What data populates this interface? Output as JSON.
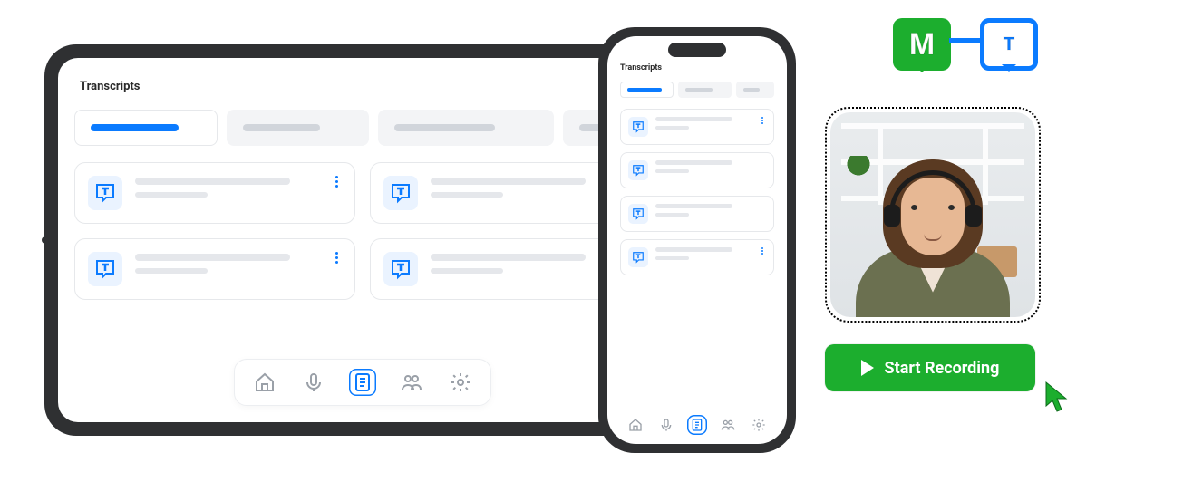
{
  "tablet": {
    "title": "Transcripts",
    "tabs": [
      {
        "active": true
      },
      {
        "active": false
      },
      {
        "active": false
      },
      {
        "active": false
      }
    ],
    "cards": [
      {
        "show_more": true
      },
      {
        "show_more": false
      },
      {
        "show_more": true
      },
      {
        "show_more": false
      }
    ],
    "dock": [
      {
        "name": "home-icon",
        "active": false
      },
      {
        "name": "mic-icon",
        "active": false
      },
      {
        "name": "transcript-icon",
        "active": true
      },
      {
        "name": "people-icon",
        "active": false
      },
      {
        "name": "settings-icon",
        "active": false
      }
    ]
  },
  "phone": {
    "title": "Transcripts",
    "tabs": [
      {
        "active": true
      },
      {
        "active": false
      },
      {
        "active": false
      }
    ],
    "cards": [
      {
        "show_more": true
      },
      {
        "show_more": false
      },
      {
        "show_more": false
      },
      {
        "show_more": true
      }
    ],
    "dock": [
      {
        "name": "home-icon",
        "active": false
      },
      {
        "name": "mic-icon",
        "active": false
      },
      {
        "name": "transcript-icon",
        "active": true
      },
      {
        "name": "people-icon",
        "active": false
      },
      {
        "name": "settings-icon",
        "active": false
      }
    ]
  },
  "badges": {
    "left_letter": "M",
    "right_letter": "T"
  },
  "record_button": {
    "label": "Start Recording"
  },
  "colors": {
    "accent": "#0b7bff",
    "green": "#1cae2e"
  }
}
